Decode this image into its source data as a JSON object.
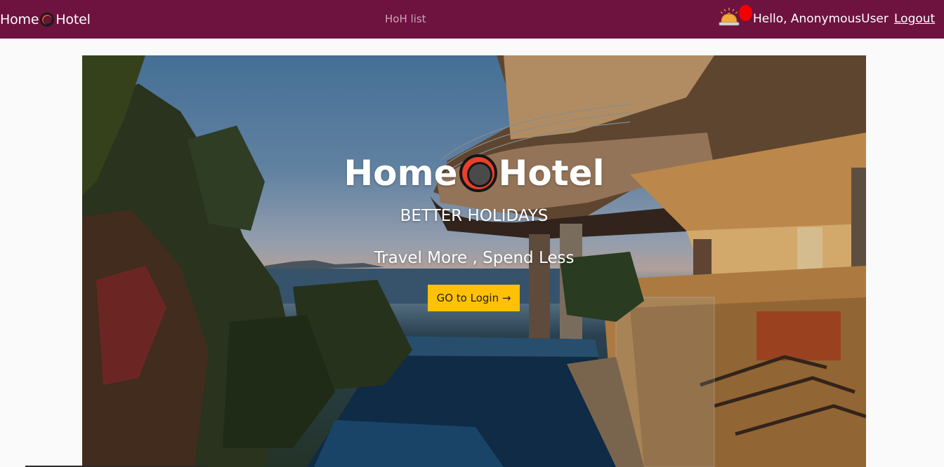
{
  "navbar": {
    "brand_left": "Home",
    "brand_right": "Hotel",
    "list_link": "HoH list",
    "greeting": "Hello, AnonymousUser",
    "logout": "Logout",
    "bell_icon": "bell-icon",
    "background_color": "#6e1240"
  },
  "hero": {
    "title_left": "Home",
    "title_right": "Hotel",
    "tagline": "BETTER HOLIDAYS",
    "slogan": "Travel More , Spend Less",
    "login_button": "GO to Login →",
    "button_color": "#ffc107"
  }
}
